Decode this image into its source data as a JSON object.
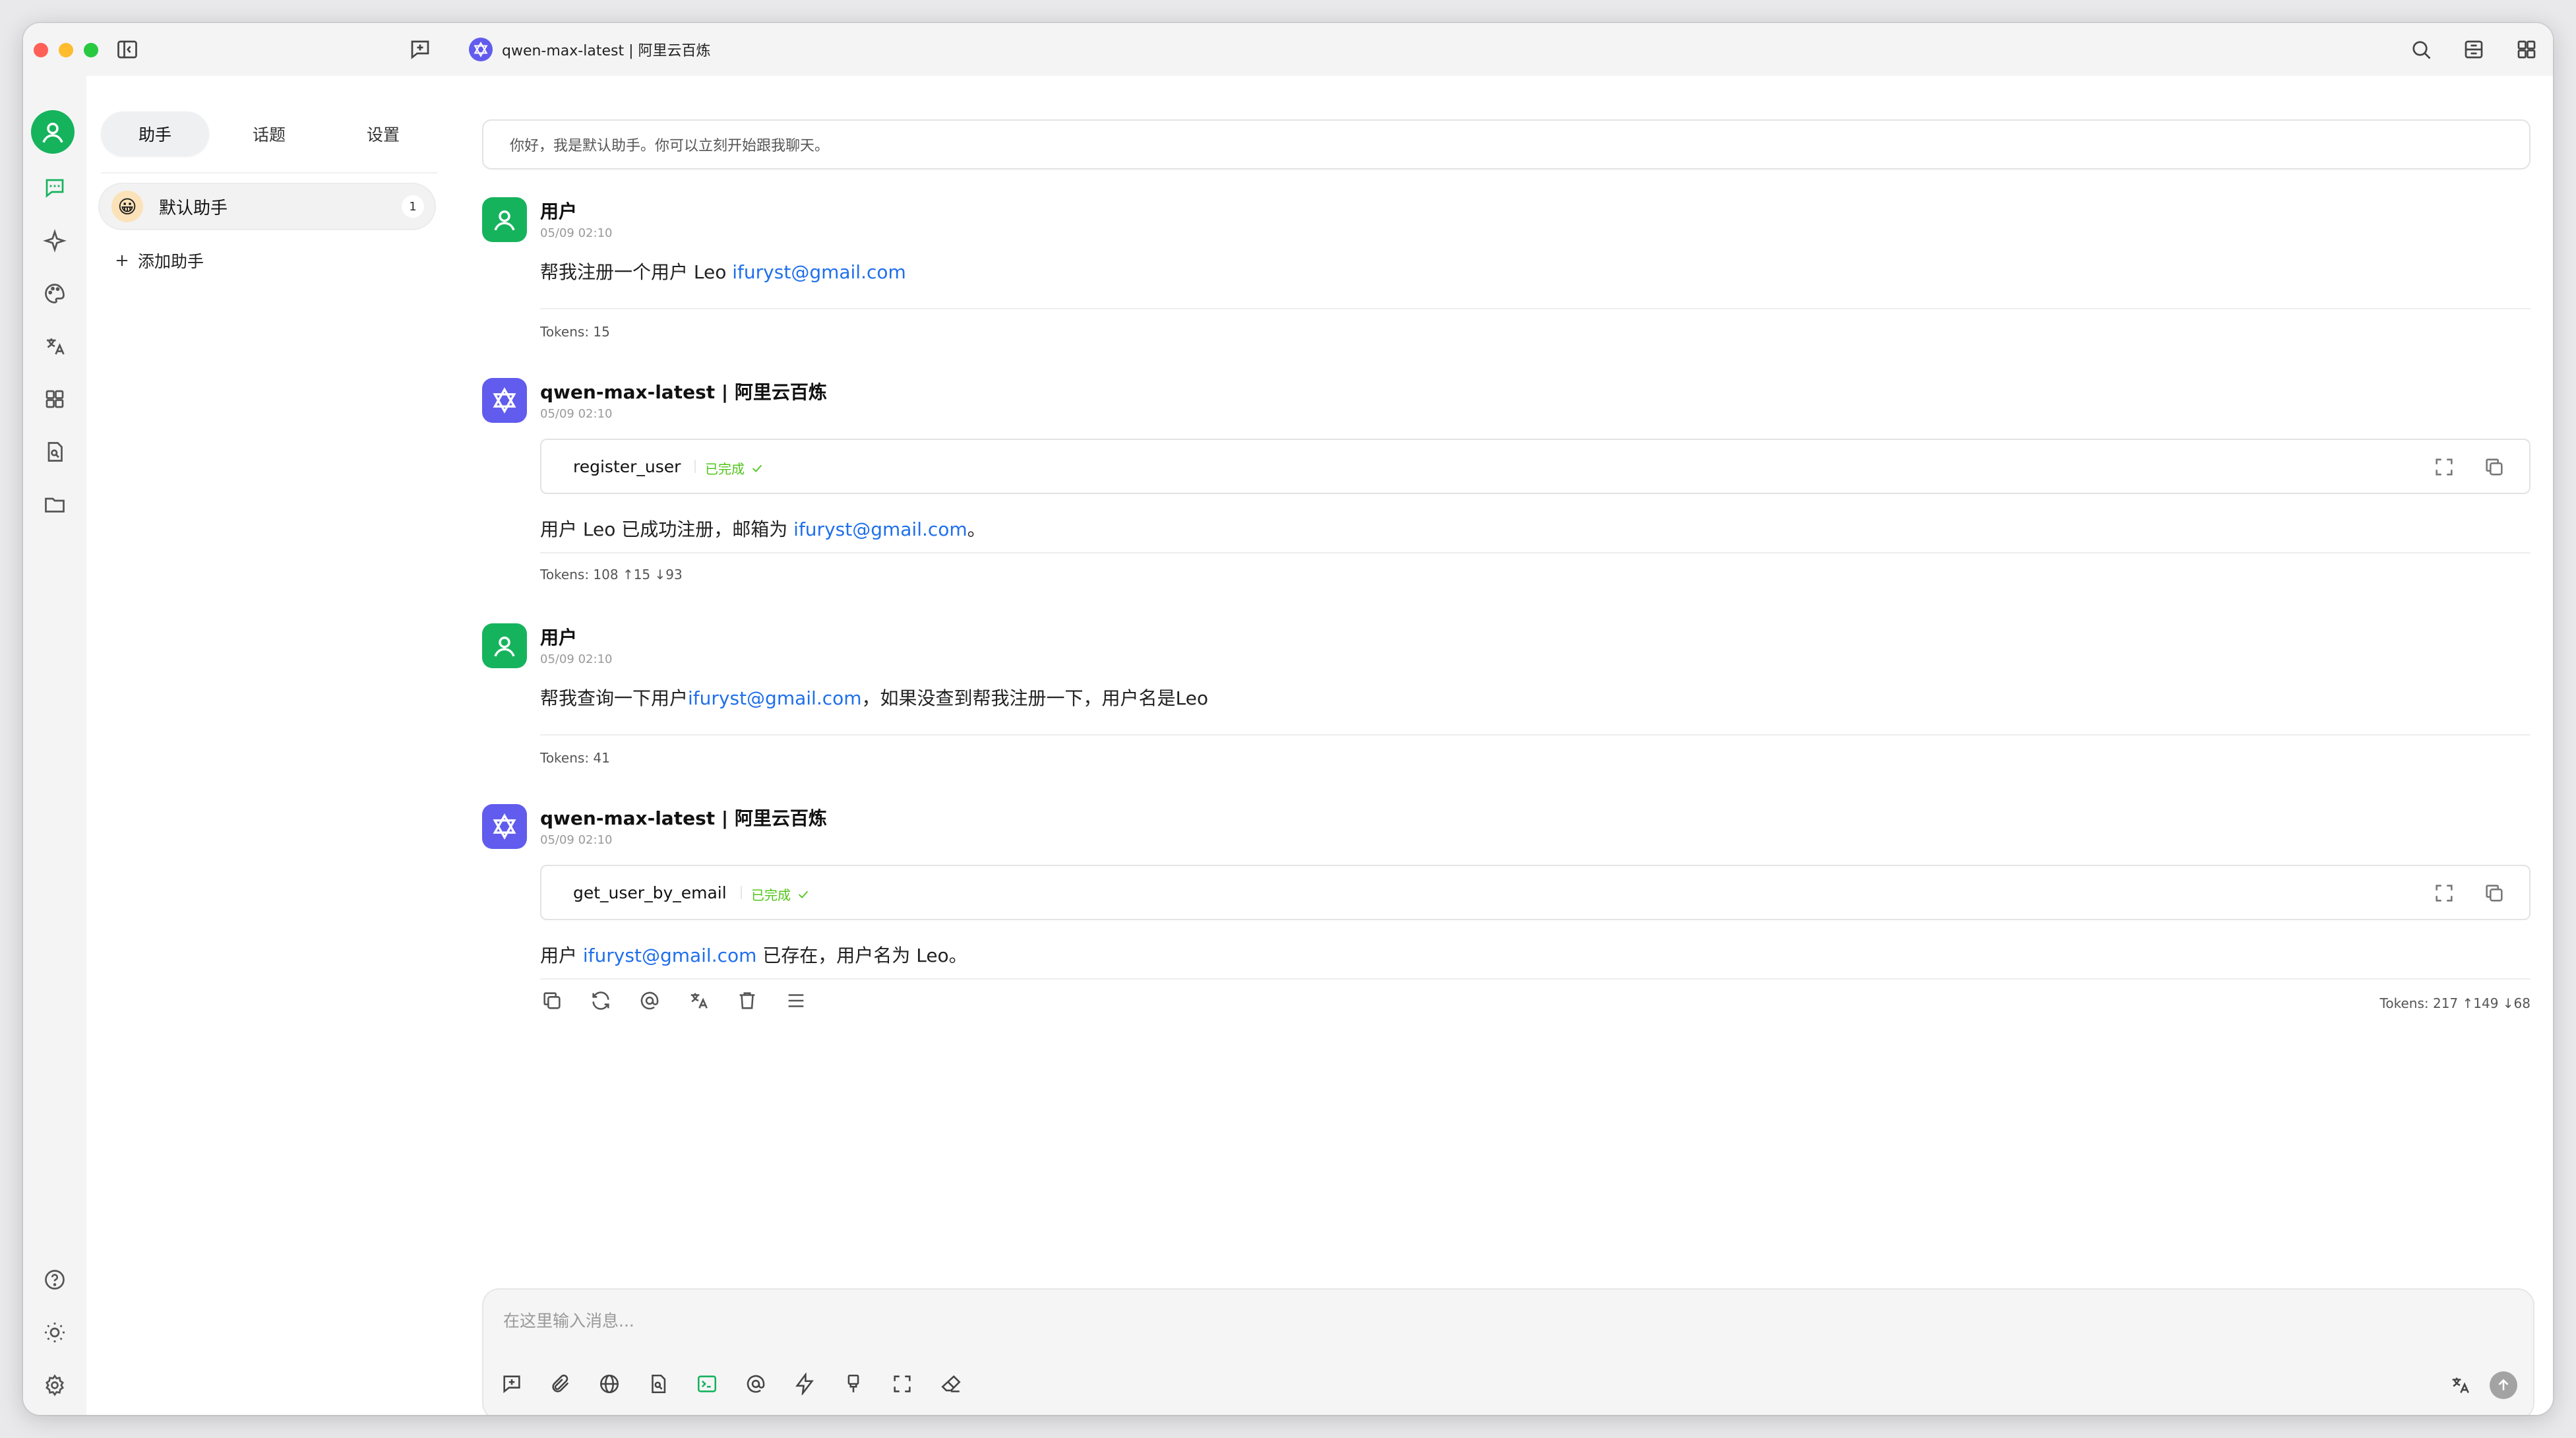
{
  "window": {
    "title": "qwen-max-latest | 阿里云百炼"
  },
  "sidebar": {
    "tabs": [
      "助手",
      "话题",
      "设置"
    ],
    "assistant": {
      "name": "默认助手",
      "count": "1",
      "emoji": "😀"
    },
    "add_label": "添加助手"
  },
  "main": {
    "prompt": "你好，我是默认助手。你可以立刻开始跟我聊天。",
    "messages": [
      {
        "role": "user",
        "name": "用户",
        "time": "05/09 02:10",
        "text_prefix": "帮我注册一个用户 Leo ",
        "link": "ifuryst@gmail.com",
        "text_suffix": "",
        "tokens": "Tokens: 15"
      },
      {
        "role": "assistant",
        "name": "qwen-max-latest | 阿里云百炼",
        "time": "05/09 02:10",
        "tool": {
          "name": "register_user",
          "status": "已完成"
        },
        "text_prefix": "用户 Leo 已成功注册，邮箱为 ",
        "link": "ifuryst@gmail.com",
        "text_suffix": "。",
        "tokens": "Tokens: 108 ↑15 ↓93"
      },
      {
        "role": "user",
        "name": "用户",
        "time": "05/09 02:10",
        "text_prefix": "帮我查询一下用户",
        "link": "ifuryst@gmail.com",
        "text_suffix": "，如果没查到帮我注册一下，用户名是Leo",
        "tokens": "Tokens: 41"
      },
      {
        "role": "assistant",
        "name": "qwen-max-latest | 阿里云百炼",
        "time": "05/09 02:10",
        "tool": {
          "name": "get_user_by_email",
          "status": "已完成"
        },
        "text_prefix": "用户 ",
        "link": "ifuryst@gmail.com",
        "text_suffix": " 已存在，用户名为 Leo。",
        "tokens": "Tokens: 217 ↑149 ↓68"
      }
    ]
  },
  "input": {
    "placeholder": "在这里输入消息..."
  },
  "colors": {
    "accent_green": "#16b35d",
    "brand_purple": "#615ced",
    "link_blue": "#1f6feb",
    "status_green": "#52c41a"
  }
}
